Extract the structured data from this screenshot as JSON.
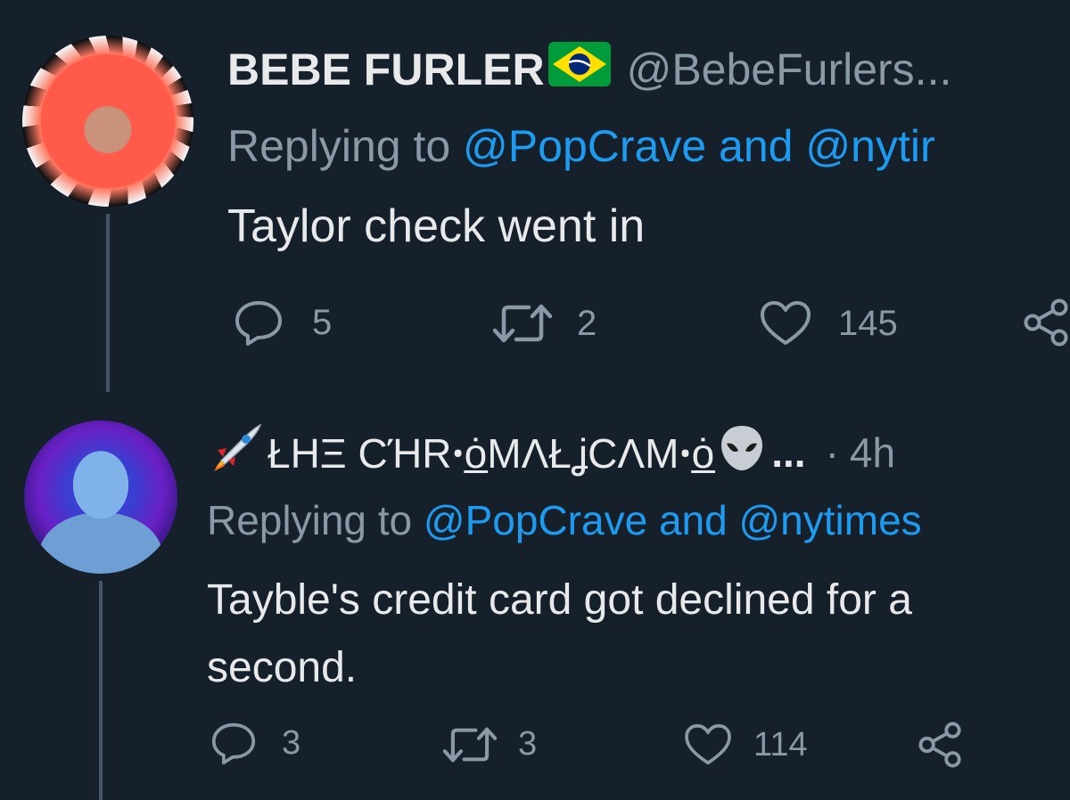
{
  "tweets": [
    {
      "display_name": "BEBE FURLER",
      "flag_icon": "brazil-flag-icon",
      "handle": "@BebeFurlers...",
      "reply_prefix": "Replying to ",
      "reply_mention1": "@PopCrave",
      "reply_and": " and ",
      "reply_mention2": "@nytir",
      "text": "Taylor check went in",
      "replies": "5",
      "retweets": "2",
      "likes": "145"
    },
    {
      "name_prefix_icon": "rocket-icon",
      "display_name": "ŁHΞ CΉRꞏȯ̲MΛŁʝCΛΜꞏȯ̲",
      "name_suffix_icon": "alien-icon",
      "ellipsis": "...",
      "separator": "·",
      "time": "4h",
      "reply_prefix": "Replying to ",
      "reply_mention1": "@PopCrave",
      "reply_and": " and ",
      "reply_mention2": "@nytimes",
      "text": "Tayble's credit card got declined for a second.",
      "replies": "3",
      "retweets": "3",
      "likes": "114"
    }
  ],
  "colors": {
    "background": "#15202b",
    "text": "#e7e9ea",
    "muted": "#8b98a5",
    "link": "#1d9bf0",
    "thread_line": "#425566"
  }
}
